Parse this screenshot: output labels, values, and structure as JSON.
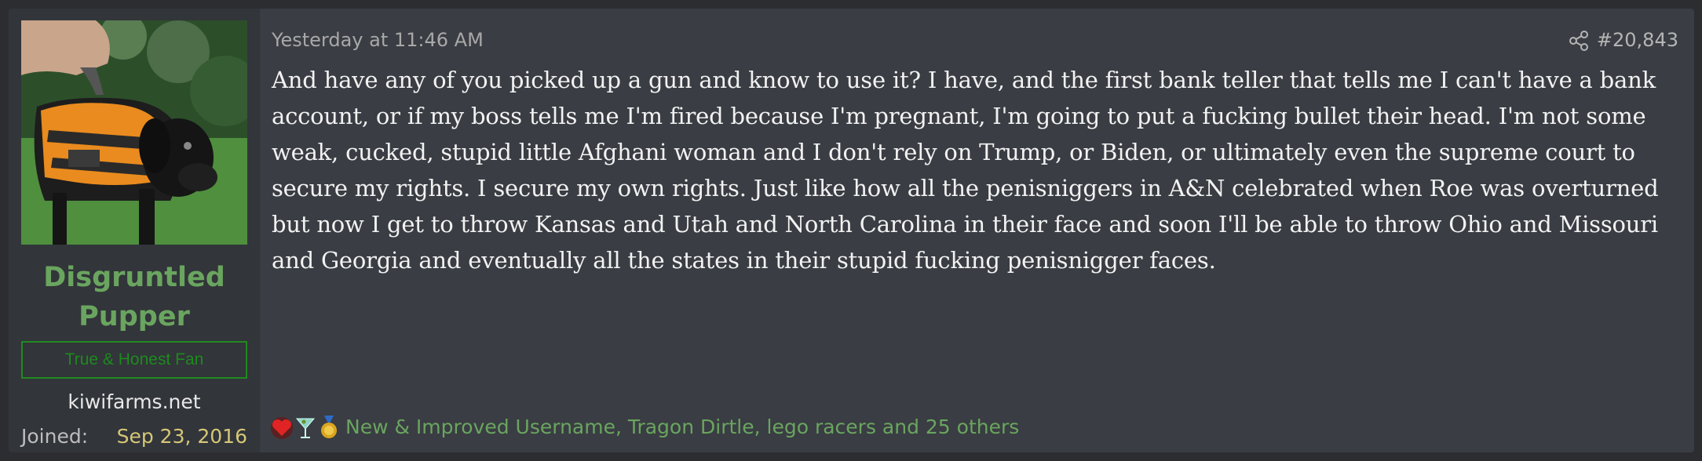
{
  "user": {
    "name_line1": "Disgruntled",
    "name_line2": "Pupper",
    "title_badge": "True & Honest Fan",
    "site": "kiwifarms.net",
    "joined_label": "Joined:",
    "joined_value": "Sep 23, 2016"
  },
  "post": {
    "timestamp": "Yesterday at 11:46 AM",
    "number": "#20,843",
    "body": "And have any of you picked up a gun and know to use it? I have, and the first bank teller that tells me I can't have a bank account, or if my boss tells me I'm fired because I'm pregnant, I'm going to put a fucking bullet their head. I'm not some weak, cucked, stupid little Afghani woman and I don't rely on Trump, or Biden, or ultimately even the supreme court to secure my rights. I secure my own rights. Just like how all the penisniggers in A&N celebrated when Roe was overturned but now I get to throw Kansas and Utah and North Carolina in their face and soon I'll be able to throw Ohio and Missouri and Georgia and eventually all the states in their stupid fucking penisnigger faces.",
    "reactions": {
      "icons": [
        "heart-icon",
        "cocktail-icon",
        "medal-icon"
      ],
      "text": "New & Improved Username, Tragon Dirtle, lego racers and 25 others"
    }
  },
  "colors": {
    "background": "#2b2d31",
    "post_background": "#3a3d43",
    "user_panel": "#32353a",
    "username": "#6aa55f",
    "badge": "#1d8a1d",
    "joined_value": "#d6c777",
    "reactors": "#6aa55f"
  }
}
